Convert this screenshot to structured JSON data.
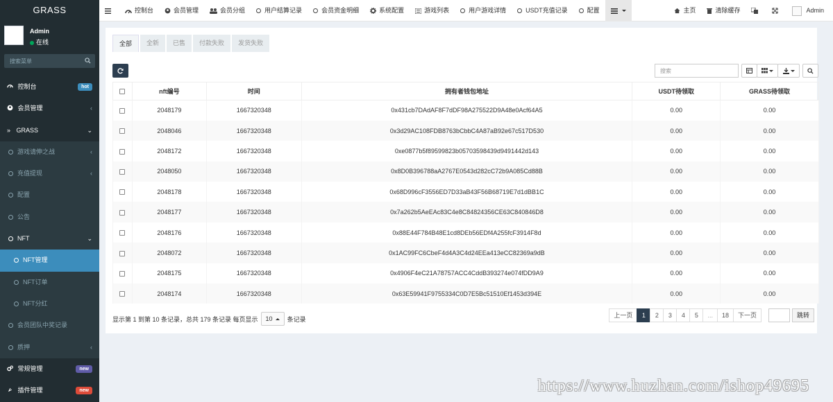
{
  "sidebar": {
    "brand": "GRASS",
    "user": {
      "name": "Admin",
      "status": "在线"
    },
    "search_placeholder": "搜索菜单",
    "items": [
      {
        "label": "控制台",
        "badge": "hot",
        "badge_color": "#3c8dbc"
      },
      {
        "label": "会员管理"
      },
      {
        "label": "GRASS"
      },
      {
        "label": "游戏请伸之战"
      },
      {
        "label": "充值提现"
      },
      {
        "label": "配置"
      },
      {
        "label": "公告"
      },
      {
        "label": "NFT"
      },
      {
        "label": "NFT管理"
      },
      {
        "label": "NFT订单"
      },
      {
        "label": "NFT分红"
      },
      {
        "label": "会员团队中奖记录"
      },
      {
        "label": "质押"
      },
      {
        "label": "常规管理",
        "badge": "new",
        "badge_color": "#605ca8"
      },
      {
        "label": "插件管理",
        "badge": "new",
        "badge_color": "#dd4b39"
      }
    ]
  },
  "header": {
    "nav": [
      "控制台",
      "会员管理",
      "会员分组",
      "用户结算记录",
      "会员资金明细",
      "系统配置",
      "游戏列表",
      "用户游戏详情",
      "USDT充值记录",
      "配置"
    ],
    "home": "主页",
    "clear_cache": "清除缓存",
    "admin": "Admin"
  },
  "tabs": [
    "全部",
    "全新",
    "已售",
    "付款失败",
    "发货失败"
  ],
  "search_placeholder": "搜索",
  "table": {
    "headers": [
      "nft编号",
      "时间",
      "拥有者钱包地址",
      "USDT待领取",
      "GRASS待领取"
    ],
    "rows": [
      [
        "2048179",
        "1667320348",
        "0x431cb7DAdAF8F7dDF98A275522D9A48e0Acf64A5",
        "0.00",
        "0.00"
      ],
      [
        "2048046",
        "1667320348",
        "0x3d29AC108FDB8763bCbbC4A87aB92e67c517D530",
        "0.00",
        "0.00"
      ],
      [
        "2048172",
        "1667320348",
        "0xe0877b5f89599823b05703598439d9491442d143",
        "0.00",
        "0.00"
      ],
      [
        "2048050",
        "1667320348",
        "0x8D0B396788aA2767E0543d282cC72b9A085Cd88B",
        "0.00",
        "0.00"
      ],
      [
        "2048178",
        "1667320348",
        "0x68D996cF3556ED7D33aB43F56B68719E7d1dBB1C",
        "0.00",
        "0.00"
      ],
      [
        "2048177",
        "1667320348",
        "0x7a262b5AeEAc83C4e8C84824356CE63C840846D8",
        "0.00",
        "0.00"
      ],
      [
        "2048176",
        "1667320348",
        "0x88E44F784B48E1cd8DEb56EDf4A255fcF3914F8d",
        "0.00",
        "0.00"
      ],
      [
        "2048072",
        "1667320348",
        "0x1AC99FC6CbeF4d4A3C4d24EEa413eCC82369a9dB",
        "0.00",
        "0.00"
      ],
      [
        "2048175",
        "1667320348",
        "0x4906F4eC21A78757ACC4CddB393274e074fDD9A9",
        "0.00",
        "0.00"
      ],
      [
        "2048174",
        "1667320348",
        "0x63E59941F9755334C0D7E5Bc51510Ef1453d394E",
        "0.00",
        "0.00"
      ]
    ]
  },
  "pager": {
    "info_prefix": "显示第 1 到第 10 条记录，总共 179 条记录 每页显示",
    "per_page": "10",
    "info_suffix": "条记录",
    "prev": "上一页",
    "pages": [
      "1",
      "2",
      "3",
      "4",
      "5",
      "...",
      "18"
    ],
    "next": "下一页",
    "jump": "跳转"
  },
  "watermark": "https://www.huzhan.com/ishop49695"
}
